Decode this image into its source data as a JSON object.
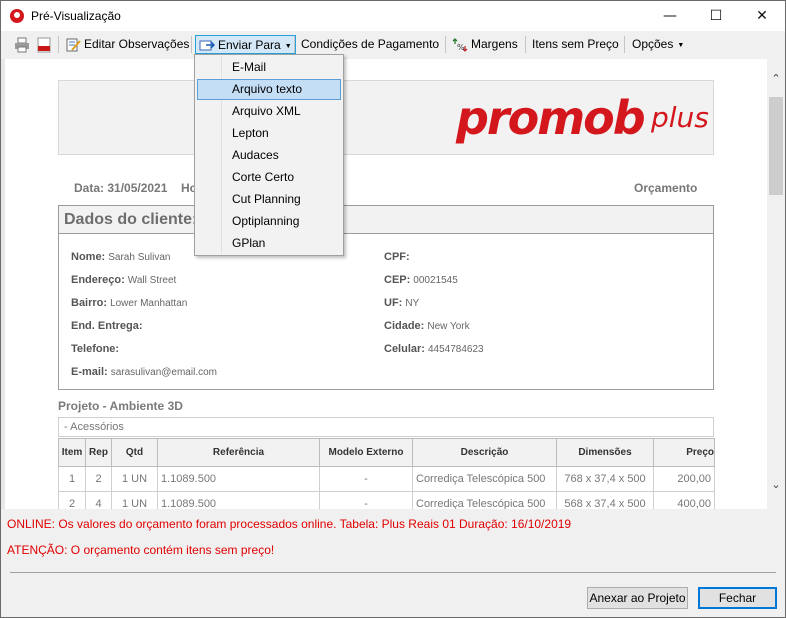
{
  "window": {
    "title": "Pré-Visualização"
  },
  "toolbar": {
    "edit_notes": "Editar Observações",
    "send_to": "Enviar Para",
    "payment": "Condições de Pagamento",
    "margins": "Margens",
    "no_price": "Itens sem Preço",
    "options": "Opções"
  },
  "send_menu": {
    "items": [
      "E-Mail",
      "Arquivo texto",
      "Arquivo XML",
      "Lepton",
      "Audaces",
      "Corte Certo",
      "Cut Planning",
      "Optiplanning",
      "GPlan"
    ],
    "highlighted": "Arquivo texto"
  },
  "report": {
    "logo_main": "promob",
    "logo_plus": "plus",
    "date_label": "Data: 31/05/2021",
    "hour_label": "Ho",
    "doc_type": "Orçamento",
    "client_title": "Dados do cliente:",
    "fields": {
      "name_label": "Nome:",
      "name_value": "Sarah Sulivan",
      "address_label": "Endereço:",
      "address_value": "Wall Street",
      "district_label": "Bairro:",
      "district_value": "Lower Manhattan",
      "delivery_label": "End. Entrega:",
      "phone_label": "Telefone:",
      "email_label": "E-mail:",
      "email_value": "sarasulivan@email.com",
      "cpf_label": "CPF:",
      "cep_label": "CEP:",
      "cep_value": "00021545",
      "uf_label": "UF:",
      "uf_value": "NY",
      "city_label": "Cidade:",
      "city_value": "New York",
      "mobile_label": "Celular:",
      "mobile_value": "4454784623"
    },
    "project_title": "Projeto - Ambiente 3D",
    "group_label": "- Acessórios",
    "table": {
      "headers": [
        "Item",
        "Rep",
        "Qtd",
        "Referência",
        "Modelo Externo",
        "Descrição",
        "Dimensões",
        "Preço"
      ],
      "rows": [
        [
          "1",
          "2",
          "1 UN",
          "1.1089.500",
          "-",
          "Corrediça Telescópica 500",
          "768 x 37,4 x 500",
          "200,00"
        ],
        [
          "2",
          "4",
          "1 UN",
          "1.1089.500",
          "-",
          "Corrediça Telescópica 500",
          "568 x 37,4 x 500",
          "400,00"
        ]
      ]
    }
  },
  "messages": {
    "online": "ONLINE: Os valores do orçamento foram processados online. Tabela:  Plus Reais 01 Duração: 16/10/2019",
    "warning": "ATENÇÃO: O orçamento contém itens sem preço!"
  },
  "buttons": {
    "attach": "Anexar ao Projeto",
    "close": "Fechar"
  },
  "colors": {
    "brand": "#d3171c",
    "message": "#e00000",
    "menu_highlight": "#c4def5"
  }
}
